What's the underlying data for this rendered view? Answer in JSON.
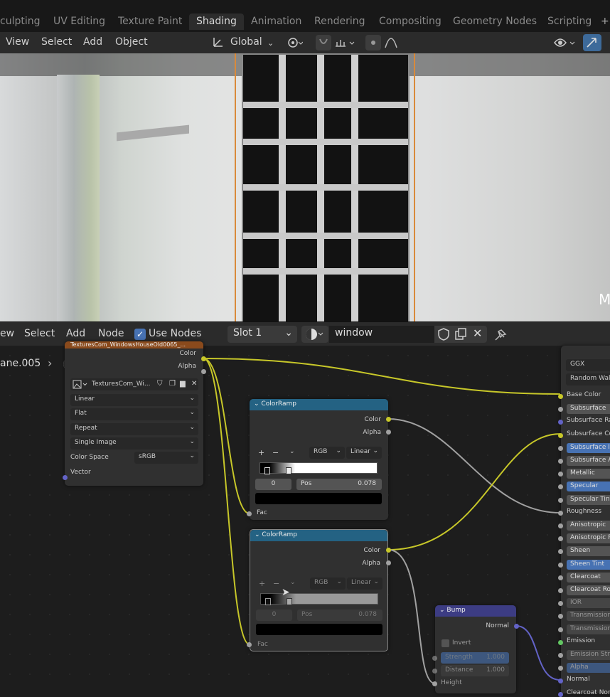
{
  "workspace_tabs": [
    "culpting",
    "UV Editing",
    "Texture Paint",
    "Shading",
    "Animation",
    "Rendering",
    "Compositing",
    "Geometry Nodes",
    "Scripting"
  ],
  "workspace_active": "Shading",
  "viewport_header": {
    "menus": [
      "View",
      "Select",
      "Add",
      "Object"
    ],
    "transform_orientation": "Global"
  },
  "viewport_overlay_text": "M",
  "node_editor_header": {
    "menus": [
      "ew",
      "Select",
      "Add",
      "Node"
    ],
    "use_nodes_label": "Use Nodes",
    "use_nodes_checked": true,
    "slot": "Slot 1",
    "material_name": "window"
  },
  "object_breadcrumb": "ane.005",
  "image_texture_node": {
    "title": "TexturesCom_WindowsHouseOld0065_...",
    "material_label": "window",
    "outputs": [
      "Color",
      "Alpha"
    ],
    "image_name": "TexturesCom_Wi...",
    "interpolation": "Linear",
    "projection": "Flat",
    "extension": "Repeat",
    "source": "Single Image",
    "color_space_label": "Color Space",
    "color_space": "sRGB",
    "input": "Vector"
  },
  "colorramp_1": {
    "title": "ColorRamp",
    "outputs": [
      "Color",
      "Alpha"
    ],
    "mode": "RGB",
    "interpolation": "Linear",
    "index": "0",
    "pos_label": "Pos",
    "pos_value": "0.078",
    "input": "Fac"
  },
  "colorramp_2": {
    "title": "ColorRamp",
    "outputs": [
      "Color",
      "Alpha"
    ],
    "mode": "RGB",
    "interpolation": "Linear",
    "index": "0",
    "pos_label": "Pos",
    "pos_value": "0.078",
    "input": "Fac"
  },
  "bump_node": {
    "title": "Bump",
    "output": "Normal",
    "invert_label": "Invert",
    "strength_label": "Strength",
    "strength_value": "1.000",
    "distance_label": "Distance",
    "distance_value": "1.000",
    "input_height": "Height"
  },
  "principled_node": {
    "distribution": "GGX",
    "subsurface_method": "Random Walk",
    "inputs": [
      "Base Color",
      "Subsurface",
      "Subsurface Ra",
      "Subsurface Col",
      "Subsurface IO",
      "Subsurface A",
      "Metallic",
      "Specular",
      "Specular Tint",
      "Roughness",
      "Anisotropic",
      "Anisotropic R",
      "Sheen",
      "Sheen Tint",
      "Clearcoat",
      "Clearcoat Rou",
      "IOR",
      "Transmission",
      "Transmission",
      "Emission",
      "Emission Str",
      "Alpha",
      "Normal",
      "Clearcoat Nor"
    ]
  },
  "colors": {
    "image_node_header": "#8a4a1c",
    "converter_header": "#246283",
    "vector_header": "#3c3c83",
    "socket_color": "#c7c729",
    "socket_float": "#a1a1a1",
    "socket_vector": "#6363c7",
    "field_blue": "#4772b3"
  }
}
